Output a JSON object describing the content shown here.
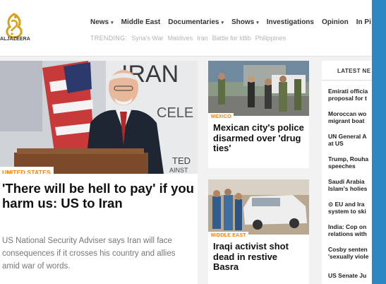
{
  "logo": {
    "name": "ALJAZEERA"
  },
  "nav": {
    "items": [
      {
        "label": "News",
        "dropdown": true
      },
      {
        "label": "Middle East",
        "dropdown": false
      },
      {
        "label": "Documentaries",
        "dropdown": true
      },
      {
        "label": "Shows",
        "dropdown": true
      },
      {
        "label": "Investigations",
        "dropdown": false
      },
      {
        "label": "Opinion",
        "dropdown": false
      },
      {
        "label": "In Pi",
        "dropdown": false
      }
    ],
    "chevron": "▾"
  },
  "trending": {
    "label": "TRENDING:",
    "items": [
      "Syria's War",
      "Maldives",
      "Iran",
      "Battle for Idlib",
      "Philippines"
    ]
  },
  "hero": {
    "category": "UNITED STATES",
    "title": "'There will be hell to pay' if you harm us: US to Iran",
    "summary": "US National Security Adviser says Iran will face consequences if it crosses his country and allies amid war of words.",
    "backdrop_text_1": "IRAN",
    "backdrop_text_2": "CELE",
    "backdrop_text_3": "TED",
    "backdrop_text_4": "AINST"
  },
  "stories": [
    {
      "category": "MEXICO",
      "title": "Mexican city's police disarmed over 'drug ties'"
    },
    {
      "category": "MIDDLE EAST",
      "title": "Iraqi activist shot dead in restive Basra"
    }
  ],
  "latest": {
    "heading": "LATEST NE",
    "items": [
      [
        "Emirati officia",
        "proposal for t"
      ],
      [
        "Moroccan wo",
        "migrant boat"
      ],
      [
        "UN General A",
        "at US"
      ],
      [
        "Trump, Rouha",
        "speeches"
      ],
      [
        "Saudi Arabia",
        "Islam's holies"
      ],
      [
        "⊙ EU and Ira",
        "system to ski"
      ],
      [
        "India: Cop on",
        "relations with"
      ],
      [
        "Cosby senten",
        "'sexually viole"
      ],
      [
        "US Senate Ju",
        ""
      ]
    ]
  },
  "colors": {
    "accent": "#ff7f00",
    "frame": "#2c86c2",
    "logo_gold": "#d9a21b"
  }
}
